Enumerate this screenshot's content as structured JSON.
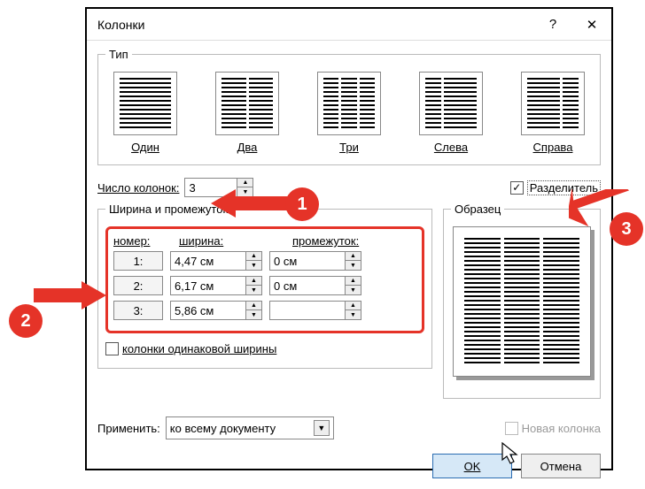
{
  "dialog": {
    "title": "Колонки",
    "help_icon": "?",
    "close_icon": "✕"
  },
  "type_group": {
    "legend": "Тип",
    "presets": [
      {
        "label": "Один",
        "cols": [
          1
        ]
      },
      {
        "label": "Два",
        "cols": [
          1,
          1
        ]
      },
      {
        "label": "Три",
        "cols": [
          1,
          1,
          1
        ]
      },
      {
        "label": "Слева",
        "cols": [
          1,
          2
        ]
      },
      {
        "label": "Справа",
        "cols": [
          2,
          1
        ]
      }
    ]
  },
  "num_cols": {
    "label": "Число колонок:",
    "value": "3"
  },
  "separator": {
    "label": "Разделитель",
    "checked": true
  },
  "width_group": {
    "legend": "Ширина и промежуток",
    "headers": {
      "num": "номер:",
      "width": "ширина:",
      "gap": "промежуток:"
    },
    "rows": [
      {
        "num": "1:",
        "width": "4,47 см",
        "gap": "0 см"
      },
      {
        "num": "2:",
        "width": "6,17 см",
        "gap": "0 см"
      },
      {
        "num": "3:",
        "width": "5,86 см",
        "gap": ""
      }
    ],
    "equal_label": "колонки одинаковой ширины",
    "equal_checked": false
  },
  "sample": {
    "legend": "Образец"
  },
  "apply": {
    "label": "Применить:",
    "value": "ко всему документу"
  },
  "new_column": {
    "label": "Новая колонка",
    "checked": false
  },
  "buttons": {
    "ok": "OK",
    "cancel": "Отмена"
  },
  "callouts": {
    "c1": "1",
    "c2": "2",
    "c3": "3"
  }
}
